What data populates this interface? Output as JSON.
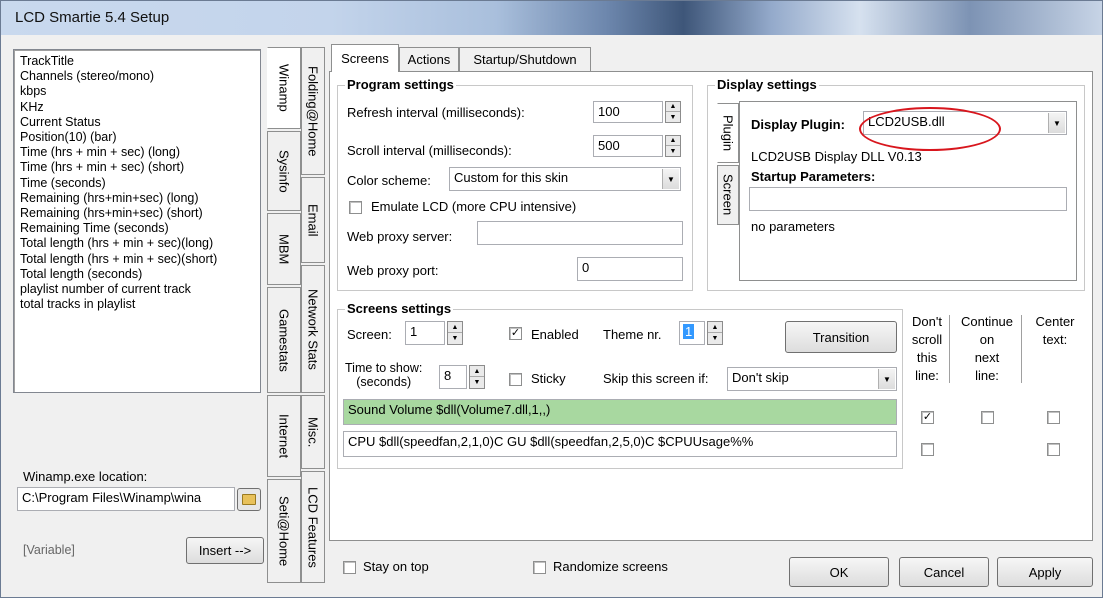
{
  "window": {
    "title": "LCD Smartie 5.4 Setup"
  },
  "left_panel": {
    "items": [
      "TrackTitle",
      "Channels (stereo/mono)",
      "kbps",
      "KHz",
      "Current Status",
      "Position(10) (bar)",
      "Time (hrs + min + sec) (long)",
      "Time (hrs + min + sec) (short)",
      "Time (seconds)",
      "Remaining (hrs+min+sec) (long)",
      "Remaining (hrs+min+sec) (short)",
      "Remaining Time (seconds)",
      "Total length (hrs + min + sec)(long)",
      "Total length (hrs + min + sec)(short)",
      "Total length (seconds)",
      "playlist number of current track",
      "total tracks in playlist"
    ],
    "location_label": "Winamp.exe location:",
    "location_value": "C:\\Program Files\\Winamp\\wina",
    "variable_label": "[Variable]",
    "insert_label": "Insert -->"
  },
  "plugin_tabs": {
    "col1": [
      "Winamp",
      "Sysinfo",
      "MBM",
      "Gamestats",
      "Internet",
      "Seti@Home"
    ],
    "col2": [
      "Folding@Home",
      "Email",
      "Network Stats",
      "Misc.",
      "LCD Features"
    ]
  },
  "main_tabs": [
    "Screens",
    "Actions",
    "Startup/Shutdown"
  ],
  "program_settings": {
    "title": "Program settings",
    "refresh_label": "Refresh interval (milliseconds):",
    "refresh_value": "100",
    "scroll_label": "Scroll interval (milliseconds):",
    "scroll_value": "500",
    "color_label": "Color scheme:",
    "color_value": "Custom for this skin",
    "emulate_label": "Emulate LCD  (more CPU intensive)",
    "proxy_server_label": "Web proxy server:",
    "proxy_server_value": "",
    "proxy_port_label": "Web proxy port:",
    "proxy_port_value": "0"
  },
  "display_settings": {
    "title": "Display settings",
    "tabs": [
      "Plugin",
      "Screen"
    ],
    "plugin_label": "Display Plugin:",
    "plugin_value": "LCD2USB.dll",
    "plugin_info": "LCD2USB Display DLL V0.13",
    "startup_label": "Startup Parameters:",
    "startup_value": "",
    "no_params": "no parameters",
    "highlight_color": "#d8161d"
  },
  "screens_settings": {
    "title": "Screens settings",
    "screen_label": "Screen:",
    "screen_value": "1",
    "enabled_label": "Enabled",
    "theme_label": "Theme nr.",
    "theme_value": "1",
    "transition_label": "Transition",
    "time_label_1": "Time to show:",
    "time_label_2": "(seconds)",
    "time_value": "8",
    "sticky_label": "Sticky",
    "skip_label": "Skip this screen if:",
    "skip_value": "Don't skip",
    "col_noscroll": [
      "Don't",
      "scroll",
      "this",
      "line:"
    ],
    "col_continue": [
      "Continue",
      "on",
      "next",
      "line:"
    ],
    "col_center": [
      "Center",
      "text:"
    ],
    "lines": [
      {
        "text": "Sound Volume $dll(Volume7.dll,1,,)",
        "highlight": true,
        "no_scroll": true,
        "continue": false,
        "center": false
      },
      {
        "text": "CPU $dll(speedfan,2,1,0)C GU $dll(speedfan,2,5,0)C  $CPUUsage%%",
        "highlight": false,
        "no_scroll": false,
        "continue": false,
        "center": false
      }
    ],
    "highlight_color": "#a8d8a0"
  },
  "bottom": {
    "stay_on_top": "Stay on top",
    "randomize": "Randomize screens",
    "ok": "OK",
    "cancel": "Cancel",
    "apply": "Apply"
  }
}
